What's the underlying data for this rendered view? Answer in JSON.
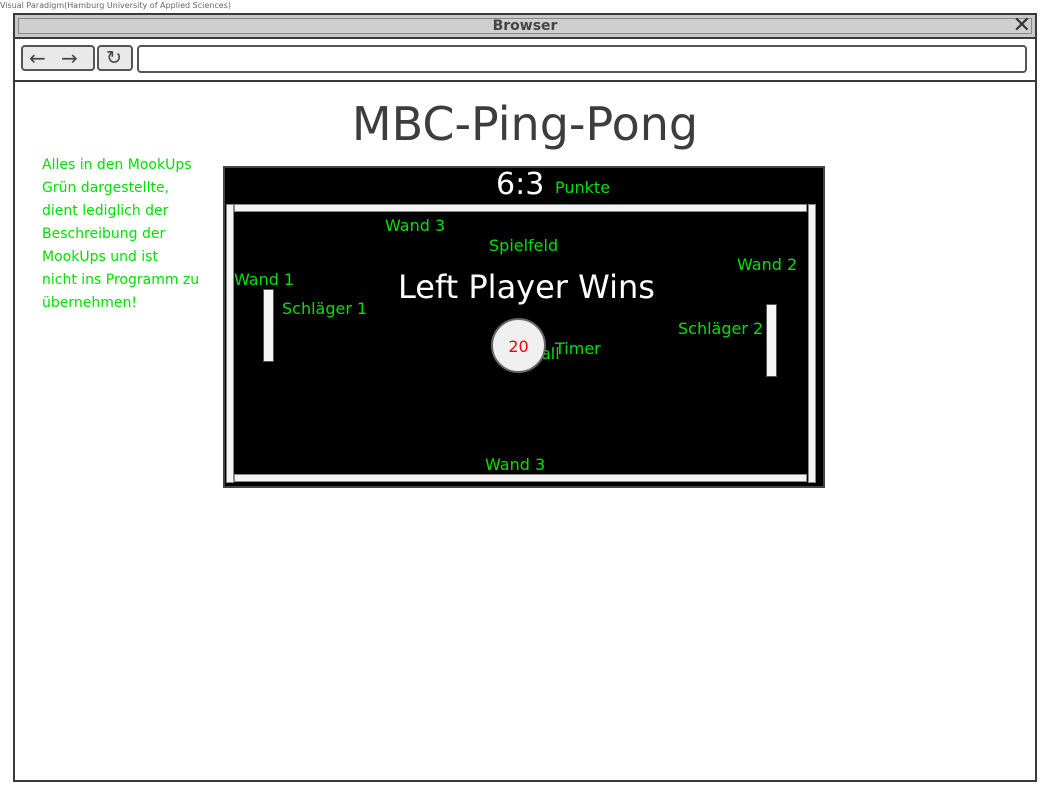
{
  "watermark": "Visual Paradigm(Hamburg University of Applied Sciences)",
  "window": {
    "title": "Browser",
    "close_icon": "close-icon",
    "toolbar": {
      "back_icon": "arrow-left-icon",
      "forward_icon": "arrow-right-icon",
      "reload_icon": "reload-icon",
      "url_value": ""
    }
  },
  "page": {
    "heading": "MBC-Ping-Pong",
    "note_lines": [
      "Alles in den MookUps",
      "Grün dargestellte,",
      "dient lediglich der",
      "Beschreibung der",
      "MookUps und ist",
      "nicht ins Programm zu",
      "übernehmen!"
    ]
  },
  "game": {
    "score": "6:3",
    "score_label": "Punkte",
    "field_label": "Spielfeld",
    "wall_top_label": "Wand 3",
    "wall_left_label": "Wand 1",
    "wall_right_label": "Wand 2",
    "wall_bottom_label": "Wand 3",
    "paddle_left_label": "Schläger 1",
    "paddle_right_label": "Schläger 2",
    "winner_text": "Left Player Wins",
    "ball_label": "all",
    "ball_timer_value": "20",
    "timer_label": "Timer"
  },
  "colors": {
    "annotation": "#00e000",
    "game_background": "#000000",
    "timer_text": "#e00000"
  }
}
